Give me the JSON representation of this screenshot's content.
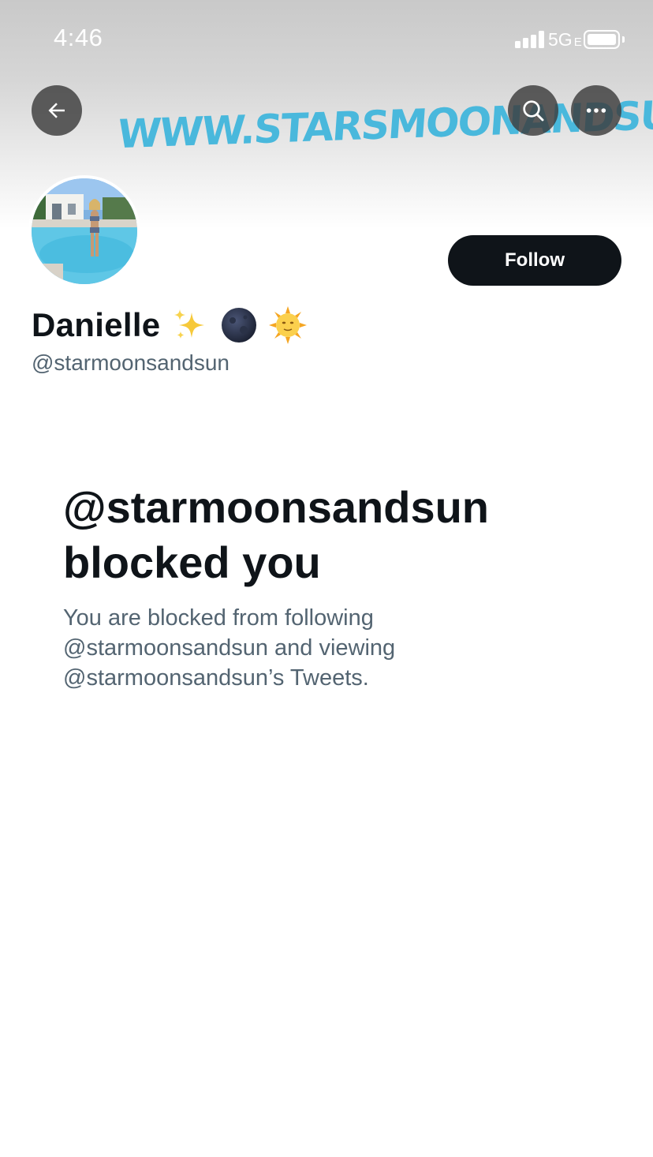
{
  "status_bar": {
    "time": "4:46",
    "network": "5G",
    "network_suffix": "E"
  },
  "header": {
    "watermark_text": "WWW.STARSMOONANDSUN.COM",
    "back_icon": "arrow-left-icon",
    "search_icon": "search-icon",
    "more_icon": "ellipsis-icon"
  },
  "profile": {
    "display_name": "Danielle",
    "name_emojis": [
      "sparkles-icon",
      "new-moon-icon",
      "sun-with-face-icon"
    ],
    "handle": "@starmoonsandsun",
    "follow_label": "Follow"
  },
  "blocked": {
    "title_line1": "@starmoonsandsun",
    "title_line2": "blocked you",
    "description_line1": "You are blocked from following",
    "description_line2": "@starmoonsandsun and viewing",
    "description_line3": "@starmoonsandsun’s Tweets."
  },
  "colors": {
    "text_primary": "#0f1419",
    "text_secondary": "#536471",
    "follow_button_bg": "#0f1419",
    "watermark": "#49b8dc"
  }
}
